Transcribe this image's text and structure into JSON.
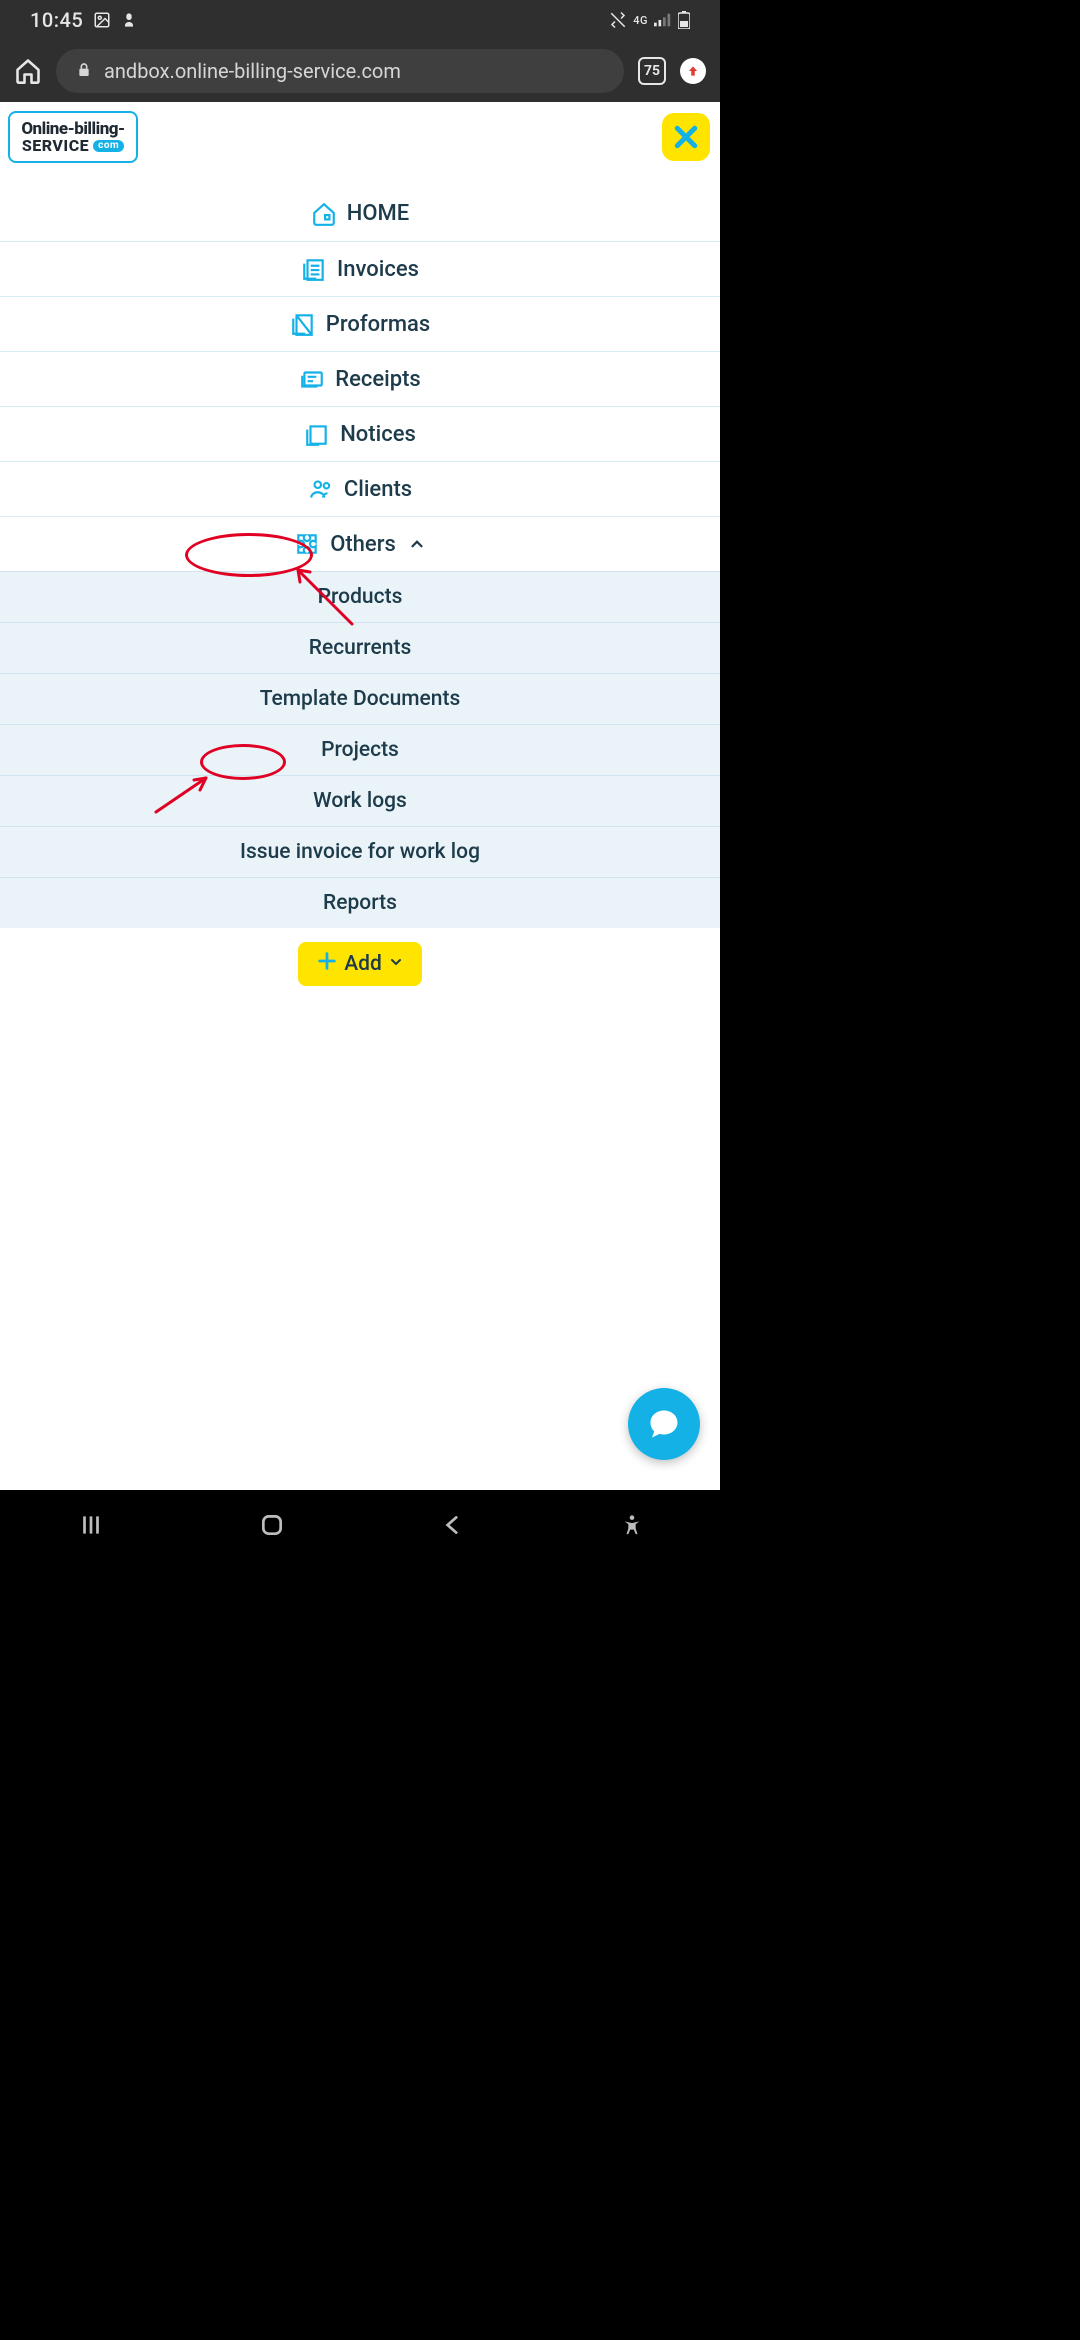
{
  "status": {
    "time": "10:45",
    "net": "4G",
    "tabs": "75"
  },
  "browser": {
    "url": "andbox.online-billing-service.com"
  },
  "logo": {
    "line1": "Online-billing-",
    "line2": "SERVICE",
    "tag": "com"
  },
  "menu": {
    "home": "HOME",
    "invoices": "Invoices",
    "proformas": "Proformas",
    "receipts": "Receipts",
    "notices": "Notices",
    "clients": "Clients",
    "others": "Others"
  },
  "submenu": {
    "products": "Products",
    "recurrents": "Recurrents",
    "templates": "Template Documents",
    "projects": "Projects",
    "worklogs": "Work logs",
    "issue": "Issue invoice for work log",
    "reports": "Reports"
  },
  "add": {
    "label": "Add"
  },
  "annotations": {
    "highlight1": "others-menu-item",
    "highlight2": "projects-sub-item"
  }
}
